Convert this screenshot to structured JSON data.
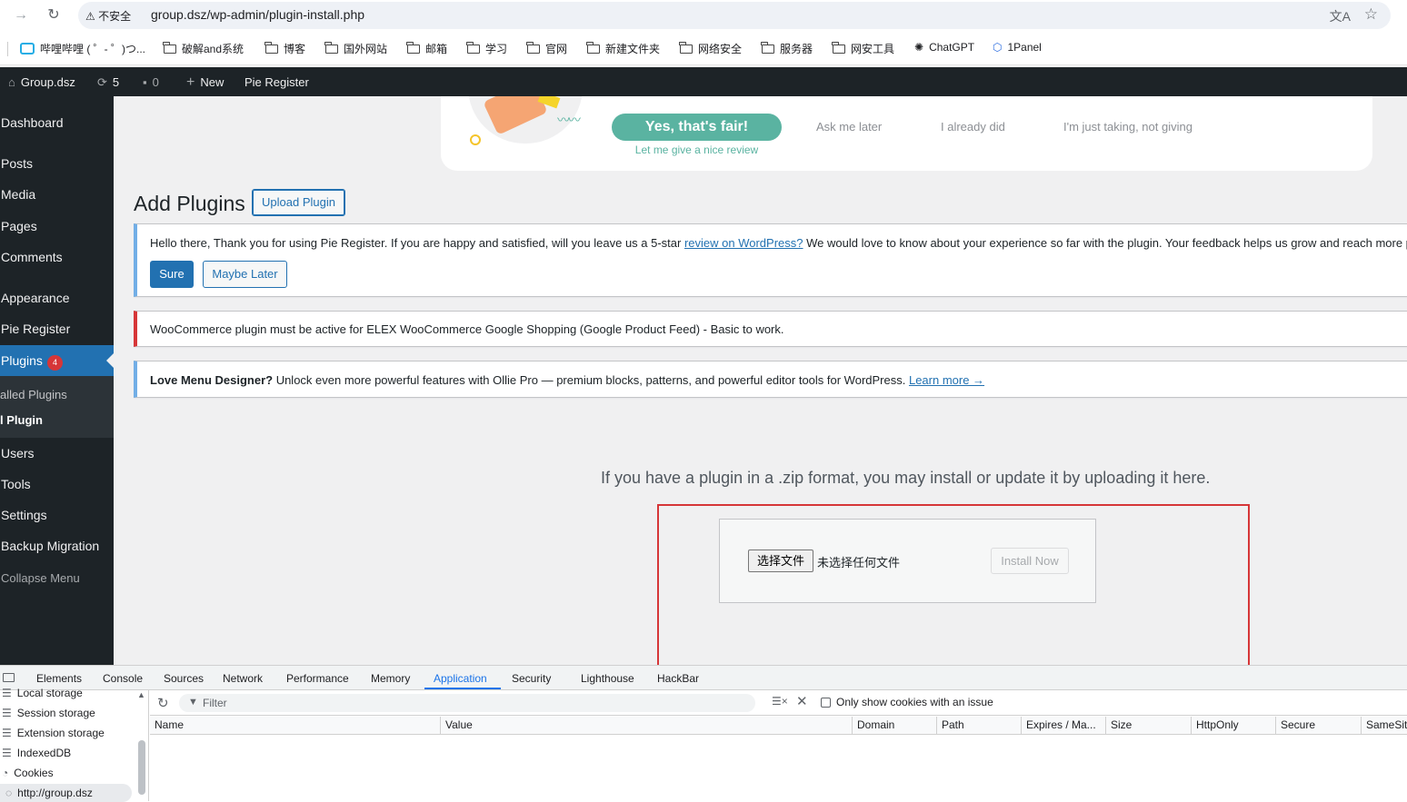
{
  "browser": {
    "insecure_label": "不安全",
    "url": "group.dsz/wp-admin/plugin-install.php",
    "bookmarks": [
      {
        "label": "哔哩哔哩 ( ゜- ゜)つ...",
        "icon": "bilibili-icon"
      },
      {
        "label": "破解and系统",
        "icon": "folder-icon"
      },
      {
        "label": "博客",
        "icon": "folder-icon"
      },
      {
        "label": "国外网站",
        "icon": "folder-icon"
      },
      {
        "label": "邮箱",
        "icon": "folder-icon"
      },
      {
        "label": "学习",
        "icon": "folder-icon"
      },
      {
        "label": "官网",
        "icon": "folder-icon"
      },
      {
        "label": "新建文件夹",
        "icon": "folder-icon"
      },
      {
        "label": "网络安全",
        "icon": "folder-icon"
      },
      {
        "label": "服务器",
        "icon": "folder-icon"
      },
      {
        "label": "网安工具",
        "icon": "folder-icon"
      },
      {
        "label": "ChatGPT",
        "icon": "openai-icon"
      },
      {
        "label": "1Panel",
        "icon": "1panel-icon"
      }
    ]
  },
  "adminbar": {
    "site_name": "Group.dsz",
    "updates_count": "5",
    "comments_count": "0",
    "new_label": "New",
    "pie_register": "Pie Register"
  },
  "sidebar": {
    "items": [
      "Dashboard",
      "Posts",
      "Media",
      "Pages",
      "Comments",
      "Appearance",
      "Pie Register",
      "Plugins",
      "Users",
      "Tools",
      "Settings",
      "Backup Migration",
      "Collapse Menu"
    ],
    "plugins_badge": "4",
    "submenu": [
      "alled Plugins",
      "l Plugin"
    ]
  },
  "review_banner": {
    "yes_label": "Yes, that's fair!",
    "yes_sub": "Let me give a nice review",
    "ask_later": "Ask me later",
    "already_did": "I already did",
    "just_taking": "I'm just taking, not giving"
  },
  "page": {
    "title": "Add Plugins",
    "upload_button": "Upload Plugin"
  },
  "notices": {
    "pie_text_before": "Hello there, Thank you for using Pie Register. If you are happy and satisfied, will you leave us a 5-star ",
    "pie_link": "review on WordPress?",
    "pie_text_after": " We would love to know about your experience so far with the plugin. Your feedback helps us grow and reach more pe",
    "sure": "Sure",
    "maybe_later": "Maybe Later",
    "woo_text": "WooCommerce plugin must be active for ELEX WooCommerce Google Shopping (Google Product Feed) - Basic to work.",
    "ollie_bold": "Love Menu Designer?",
    "ollie_text": " Unlock even more powerful features with Ollie Pro — premium blocks, patterns, and powerful editor tools for WordPress. ",
    "ollie_link": "Learn more →"
  },
  "upload": {
    "help_text": "If you have a plugin in a .zip format, you may install or update it by uploading it here.",
    "choose_file": "选择文件",
    "no_file": "未选择任何文件",
    "install_now": "Install Now"
  },
  "devtools": {
    "tabs": [
      "Elements",
      "Console",
      "Sources",
      "Network",
      "Performance",
      "Memory",
      "Application",
      "Security",
      "Lighthouse",
      "HackBar"
    ],
    "active_tab": "Application",
    "tree": [
      "Local storage",
      "Session storage",
      "Extension storage",
      "IndexedDB",
      "Cookies",
      "http://group.dsz"
    ],
    "filter_placeholder": "Filter",
    "only_issue_label": "Only show cookies with an issue",
    "columns": [
      "Name",
      "Value",
      "Domain",
      "Path",
      "Expires / Ma...",
      "Size",
      "HttpOnly",
      "Secure",
      "SameSit"
    ]
  },
  "colors": {
    "wp_admin_dark": "#1d2327",
    "wp_blue": "#2271b1",
    "highlight_red": "#d63638",
    "review_teal": "#5ab3a1",
    "devtools_blue": "#1a73e8"
  }
}
